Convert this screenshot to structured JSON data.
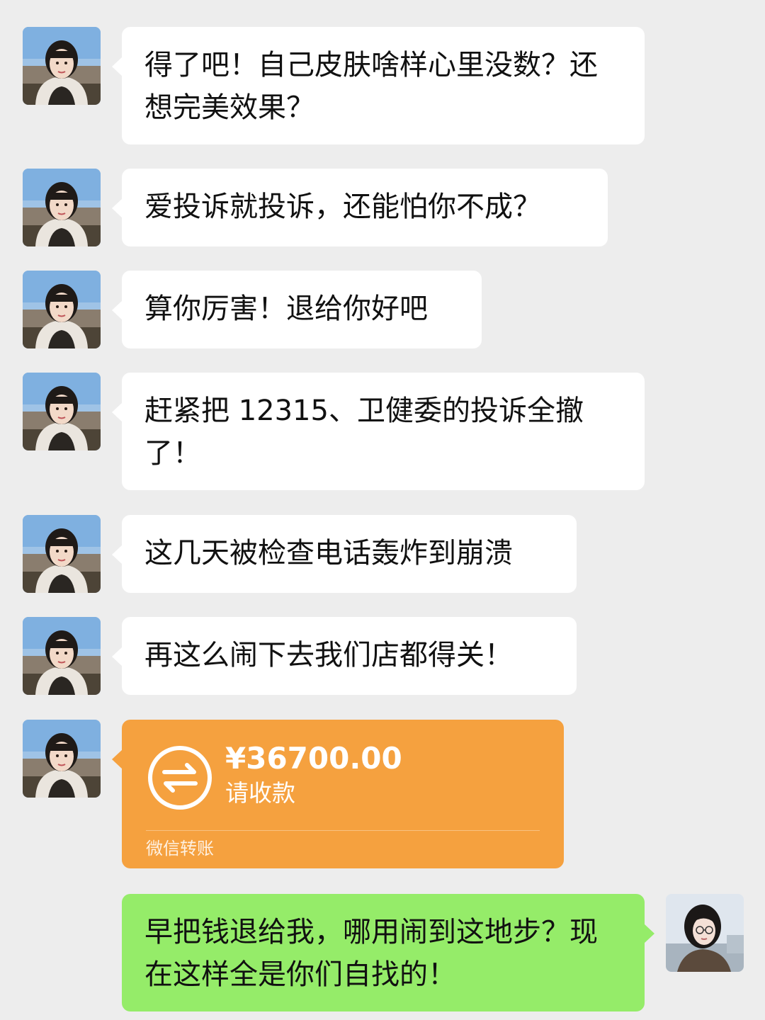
{
  "conversation": {
    "messages": [
      {
        "sender": "other",
        "text": "得了吧！自己皮肤啥样心里没数？还想完美效果？"
      },
      {
        "sender": "other",
        "text": "爱投诉就投诉，还能怕你不成？"
      },
      {
        "sender": "other",
        "text": "算你厉害！退给你好吧"
      },
      {
        "sender": "other",
        "text": "赶紧把 12315、卫健委的投诉全撤了！"
      },
      {
        "sender": "other",
        "text": "这几天被检查电话轰炸到崩溃"
      },
      {
        "sender": "other",
        "text": "再这么闹下去我们店都得关！"
      },
      {
        "sender": "other",
        "type": "transfer",
        "amount": "¥36700.00",
        "status": "请收款",
        "label": "微信转账",
        "icon": "transfer-arrows-icon",
        "color": "#f5a13f"
      },
      {
        "sender": "self",
        "text": "早把钱退给我，哪用闹到这地步？现在这样全是你们自找的！"
      }
    ]
  },
  "colors": {
    "background": "#ededed",
    "bubble_other": "#ffffff",
    "bubble_self": "#95ec69",
    "transfer": "#f5a13f"
  }
}
